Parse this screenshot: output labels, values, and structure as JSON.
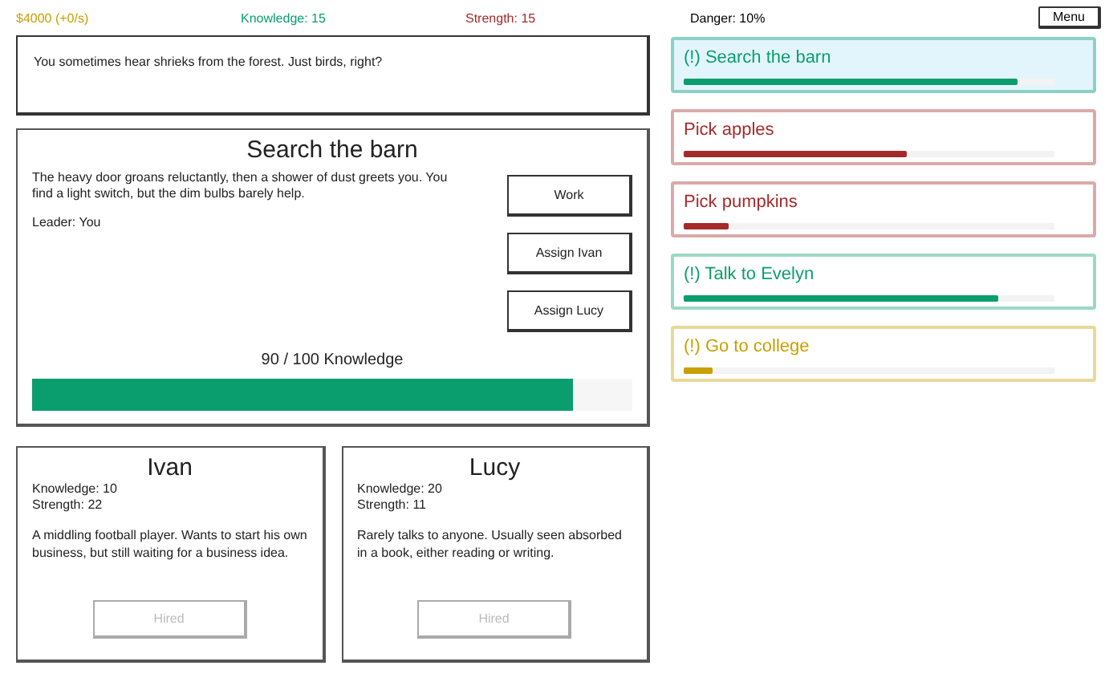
{
  "stats": [
    {
      "label": "$4000 (+0/s)",
      "color": "#c9a000"
    },
    {
      "label": "Knowledge: 15",
      "color": "#0a9e6e"
    },
    {
      "label": "Strength: 15",
      "color": "#a52a2a"
    },
    {
      "label": "Danger: 10%",
      "color": "#000000"
    }
  ],
  "menu_button": "Menu",
  "message": "You sometimes hear shrieks from the forest. Just birds, right?",
  "task": {
    "title": "Search the barn",
    "description": "The heavy door groans reluctantly, then a shower of dust greets you. You find a light switch, but the dim bulbs barely help.",
    "leader": "Leader: You",
    "buttons": [
      "Work",
      "Assign Ivan",
      "Assign Lucy"
    ],
    "progress_text": "90 / 100 Knowledge",
    "level": 0.9
  },
  "workers": [
    {
      "name": "Ivan",
      "knowledge": "Knowledge: 10",
      "strength": "Strength: 22",
      "bio": "A middling football player. Wants to start his own business, but still waiting for a business idea.",
      "button": "Hired",
      "disabled": true
    },
    {
      "name": "Lucy",
      "knowledge": "Knowledge: 20",
      "strength": "Strength: 11",
      "bio": "Rarely talks to anyone. Usually seen absorbed in a book, either reading or writing.",
      "button": "Hired",
      "disabled": true
    }
  ],
  "quests": [
    {
      "label": "(!) Search the barn",
      "color": "#0a9e6e",
      "selected": true,
      "level": 0.9
    },
    {
      "label": "Pick apples",
      "color": "#a52a2a",
      "selected": false,
      "level": 0.6
    },
    {
      "label": "Pick pumpkins",
      "color": "#a52a2a",
      "selected": false,
      "level": 0.12
    },
    {
      "label": "(!) Talk to Evelyn",
      "color": "#0a9e6e",
      "selected": false,
      "level": 0.85
    },
    {
      "label": "(!) Go to college",
      "color": "#c9a000",
      "selected": false,
      "level": 0.08
    }
  ]
}
